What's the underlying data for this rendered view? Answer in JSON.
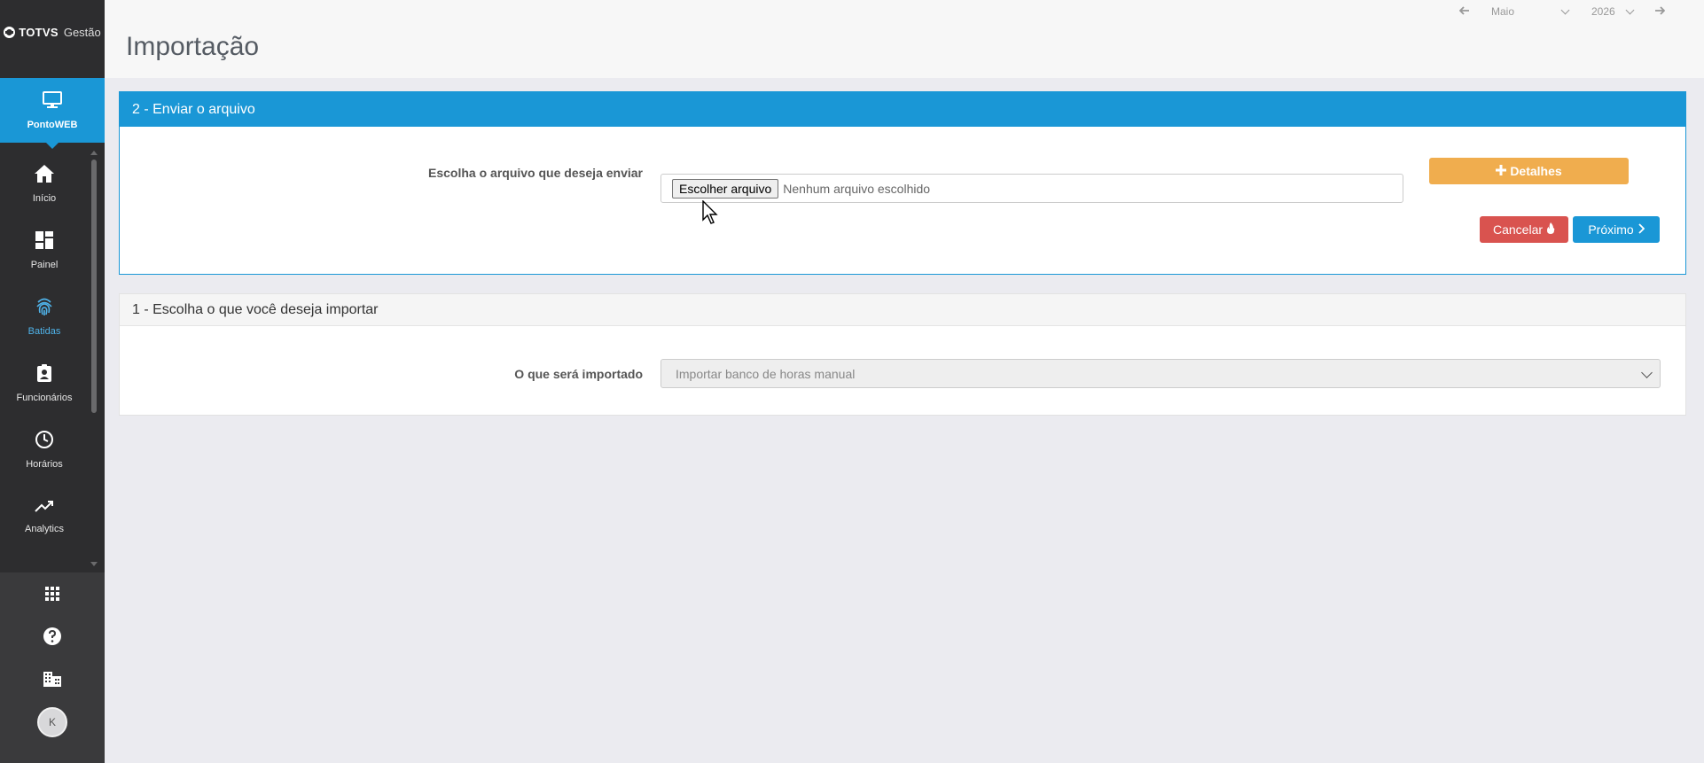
{
  "brand": {
    "name": "TOTVS",
    "product": "Gestão"
  },
  "sidebar": {
    "active_item": {
      "label": "PontoWEB",
      "icon": "monitor-icon"
    },
    "items": [
      {
        "label": "Início",
        "icon": "home-icon"
      },
      {
        "label": "Painel",
        "icon": "dashboard-icon"
      },
      {
        "label": "Batidas",
        "icon": "fingerprint-icon"
      },
      {
        "label": "Funcionários",
        "icon": "badge-icon"
      },
      {
        "label": "Horários",
        "icon": "clock-icon"
      },
      {
        "label": "Analytics",
        "icon": "trend-icon"
      }
    ],
    "bottom": {
      "icons": [
        "apps-grid-icon",
        "help-icon",
        "building-icon"
      ],
      "avatar_initial": "K"
    }
  },
  "header": {
    "title": "Importação",
    "date_nav": {
      "month": "Maio",
      "year": "2026"
    }
  },
  "step2": {
    "title": "2 - Enviar o arquivo",
    "file_label": "Escolha o arquivo que deseja enviar",
    "file_button": "Escolher arquivo",
    "file_status": "Nenhum arquivo escolhido",
    "details_button": "Detalhes",
    "cancel_button": "Cancelar",
    "next_button": "Próximo"
  },
  "step1": {
    "title": "1 - Escolha o que você deseja importar",
    "import_label": "O que será importado",
    "import_value": "Importar banco de horas manual"
  },
  "colors": {
    "primary": "#1a97d6",
    "warning": "#f0ad4e",
    "danger": "#d9534f",
    "sidebar": "#2d2d2f"
  }
}
